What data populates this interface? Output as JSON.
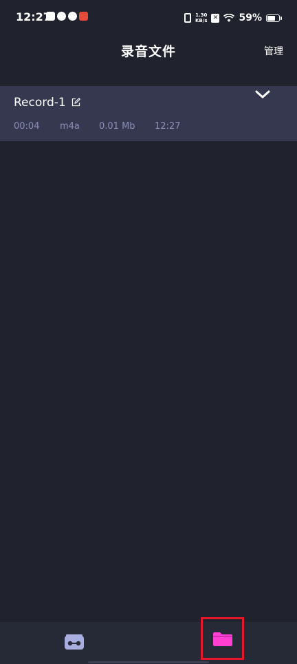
{
  "status_bar": {
    "time": "12:27",
    "network_speed_value": "1.30",
    "network_speed_unit": "KB/s",
    "battery_percent": "59%",
    "battery_level": 0.59
  },
  "header": {
    "title": "录音文件",
    "manage_label": "管理"
  },
  "records": [
    {
      "name": "Record-1",
      "duration": "00:04",
      "format": "m4a",
      "size": "0.01 Mb",
      "time": "12:27"
    }
  ],
  "bottom_nav": {
    "items": [
      {
        "icon": "recorder-icon",
        "active": false
      },
      {
        "icon": "folder-icon",
        "active": true
      }
    ]
  },
  "colors": {
    "background": "#20222e",
    "record_item_background": "#363850",
    "meta_text": "#8b8fb7",
    "bottom_nav_background": "#262936",
    "recorder_icon": "#a9aee0",
    "folder_icon_active": "#ff3fd2",
    "highlight_box": "#e3192b"
  }
}
